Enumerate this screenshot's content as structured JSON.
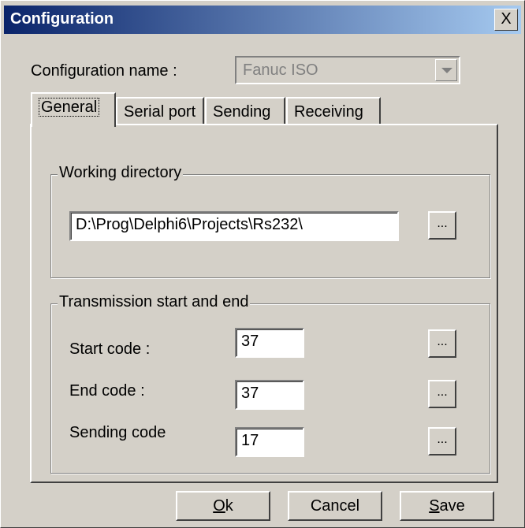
{
  "window": {
    "title": "Configuration",
    "close_label": "X"
  },
  "config": {
    "label": "Configuration name :",
    "value": "Fanuc ISO"
  },
  "tabs": [
    {
      "label": "General"
    },
    {
      "label": "Serial port"
    },
    {
      "label": "Sending"
    },
    {
      "label": "Receiving"
    }
  ],
  "working_directory": {
    "title": "Working directory",
    "path": "D:\\Prog\\Delphi6\\Projects\\Rs232\\",
    "browse_label": "..."
  },
  "transmission": {
    "title": "Transmission start and end",
    "start_label": "Start code :",
    "start_value": "37",
    "end_label": "End code :",
    "end_value": "37",
    "sending_label": "Sending code",
    "sending_value": "17",
    "browse_label": "..."
  },
  "buttons": {
    "ok_mnemonic": "O",
    "ok_rest": "k",
    "cancel": "Cancel",
    "save_mnemonic": "S",
    "save_rest": "ave"
  }
}
